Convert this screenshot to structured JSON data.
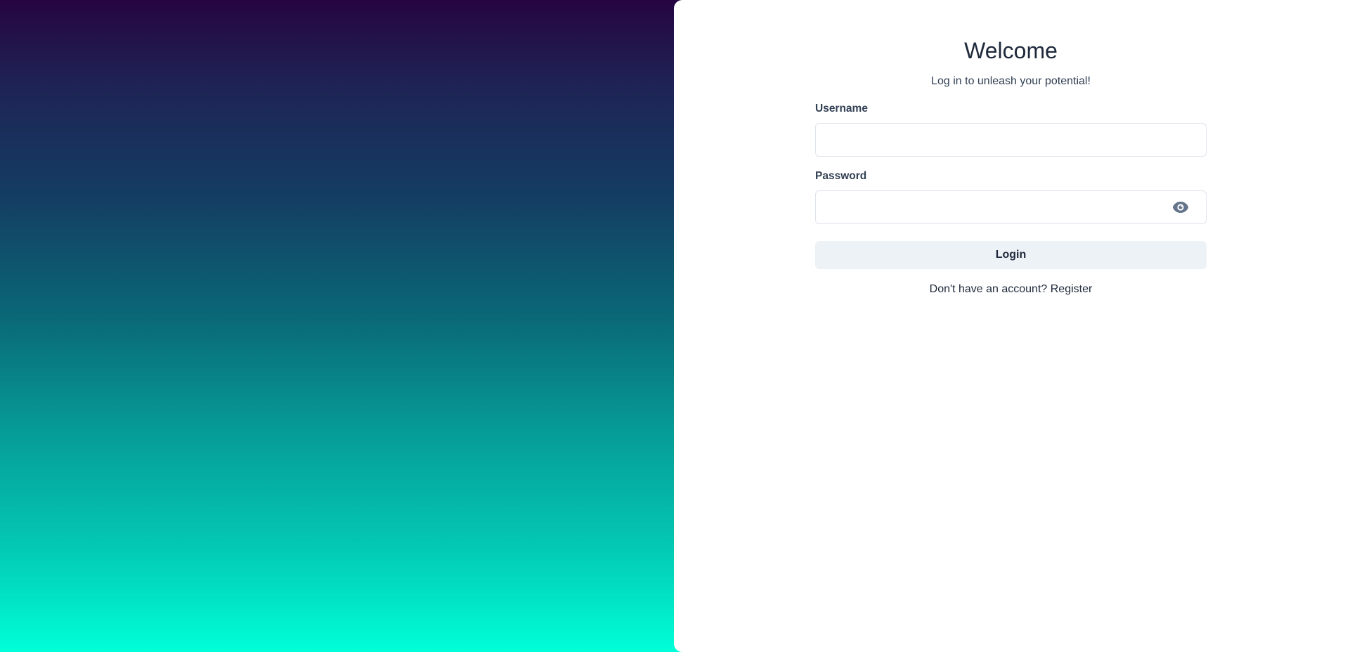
{
  "login": {
    "title": "Welcome",
    "subtitle": "Log in to unleash your potential!",
    "username_label": "Username",
    "username_value": "",
    "password_label": "Password",
    "password_value": "",
    "password_toggle_icon": "eye-icon",
    "submit_label": "Login",
    "register_prompt": "Don't have an account?",
    "register_link": "Register"
  },
  "colors": {
    "gradient_top": "#260541",
    "gradient_bottom": "#00ffd8",
    "button_background": "#edf2f7",
    "icon": "#64748b"
  }
}
